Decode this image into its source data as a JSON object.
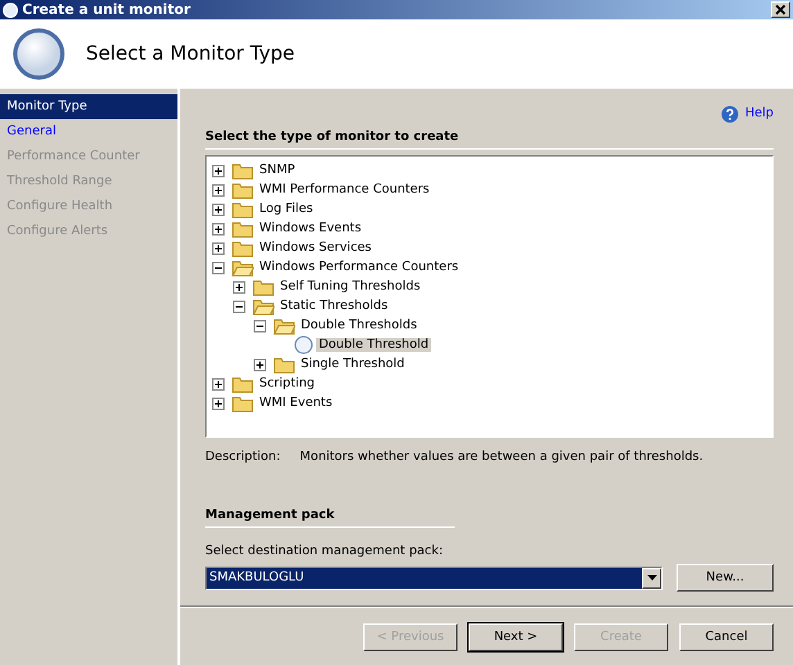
{
  "window": {
    "title": "Create a unit monitor"
  },
  "header": {
    "title": "Select a Monitor Type"
  },
  "sidebar": {
    "items": [
      {
        "label": "Monitor Type",
        "selected": true,
        "disabled": false
      },
      {
        "label": "General",
        "selected": false,
        "disabled": false
      },
      {
        "label": "Performance Counter",
        "selected": false,
        "disabled": true
      },
      {
        "label": "Threshold Range",
        "selected": false,
        "disabled": true
      },
      {
        "label": "Configure Health",
        "selected": false,
        "disabled": true
      },
      {
        "label": "Configure Alerts",
        "selected": false,
        "disabled": true
      }
    ]
  },
  "help_link": "Help",
  "monitor_type": {
    "heading": "Select the type of monitor to create",
    "tree": [
      {
        "kind": "folder",
        "label": "SNMP",
        "expanded": false,
        "selected": false
      },
      {
        "kind": "folder",
        "label": "WMI Performance Counters",
        "expanded": false,
        "selected": false
      },
      {
        "kind": "folder",
        "label": "Log Files",
        "expanded": false,
        "selected": false
      },
      {
        "kind": "folder",
        "label": "Windows Events",
        "expanded": false,
        "selected": false
      },
      {
        "kind": "folder",
        "label": "Windows Services",
        "expanded": false,
        "selected": false
      },
      {
        "kind": "folder",
        "label": "Windows Performance Counters",
        "expanded": true,
        "selected": false,
        "children": [
          {
            "kind": "folder",
            "label": "Self Tuning Thresholds",
            "expanded": false,
            "selected": false
          },
          {
            "kind": "folder",
            "label": "Static Thresholds",
            "expanded": true,
            "selected": false,
            "children": [
              {
                "kind": "folder",
                "label": "Double Thresholds",
                "expanded": true,
                "selected": false,
                "children": [
                  {
                    "kind": "monitor",
                    "label": "Double Threshold",
                    "selected": true
                  }
                ]
              },
              {
                "kind": "folder",
                "label": "Single Threshold",
                "expanded": false,
                "selected": false
              }
            ]
          }
        ]
      },
      {
        "kind": "folder",
        "label": "Scripting",
        "expanded": false,
        "selected": false
      },
      {
        "kind": "folder",
        "label": "WMI Events",
        "expanded": false,
        "selected": false
      }
    ],
    "description_label": "Description:",
    "description": "Monitors whether values are between a given pair of thresholds."
  },
  "management_pack": {
    "heading": "Management pack",
    "label": "Select destination management pack:",
    "value": "SMAKBULOGLU",
    "new_button": "New..."
  },
  "buttons": [
    {
      "label": "< Previous",
      "disabled": true,
      "default": false
    },
    {
      "label": "Next >",
      "disabled": false,
      "default": true
    },
    {
      "label": "Create",
      "disabled": true,
      "default": false
    },
    {
      "label": "Cancel",
      "disabled": false,
      "default": false
    }
  ]
}
